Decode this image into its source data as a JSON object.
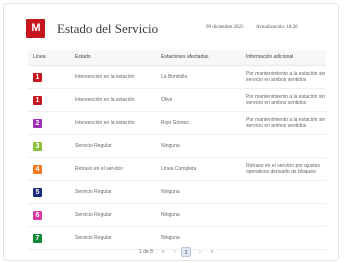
{
  "header": {
    "logo_text": "M",
    "title": "Estado del Servicio",
    "date": "09 diciembre 2025",
    "updated": "Actualización: 18:26"
  },
  "table": {
    "headers": [
      "Línea",
      "Estado",
      "Estaciones afectadas",
      "Información adicional"
    ],
    "rows": [
      {
        "line": "1",
        "color": "#c7171e",
        "estado": "Intervención en la estación",
        "estaciones": "La Bombilla",
        "info": "Por mantenimiento a la estación sin servicio en ambos sentidos"
      },
      {
        "line": "1",
        "color": "#c7171e",
        "estado": "Intervención en la estación",
        "estaciones": "Olivo",
        "info": "Por mantenimiento a la estación sin servicio en ambos sentidos"
      },
      {
        "line": "2",
        "color": "#9b2fb5",
        "estado": "Intervención en la estación",
        "estaciones": "Rojo Gómez",
        "info": "Por mantenimiento a la estación sin servicio en ambos sentidos"
      },
      {
        "line": "3",
        "color": "#8bc23c",
        "estado": "Servicio Regular",
        "estaciones": "Ninguna",
        "info": ""
      },
      {
        "line": "4",
        "color": "#ef7b22",
        "estado": "Retraso en el servicio",
        "estaciones": "Línea Completa",
        "info": "Retraso en el servicio por ajustes operativos derivado de bloqueo"
      },
      {
        "line": "5",
        "color": "#1d2b7c",
        "estado": "Servicio Regular",
        "estaciones": "Ninguna",
        "info": ""
      },
      {
        "line": "6",
        "color": "#d63ba3",
        "estado": "Servicio Regular",
        "estaciones": "Ninguna",
        "info": ""
      },
      {
        "line": "7",
        "color": "#0f8a3a",
        "estado": "Servicio Regular",
        "estaciones": "Ninguna",
        "info": ""
      }
    ]
  },
  "pagination": {
    "info": "1 de 8",
    "first": "«",
    "prev": "‹",
    "current": "1",
    "next": "›",
    "last": "»"
  }
}
